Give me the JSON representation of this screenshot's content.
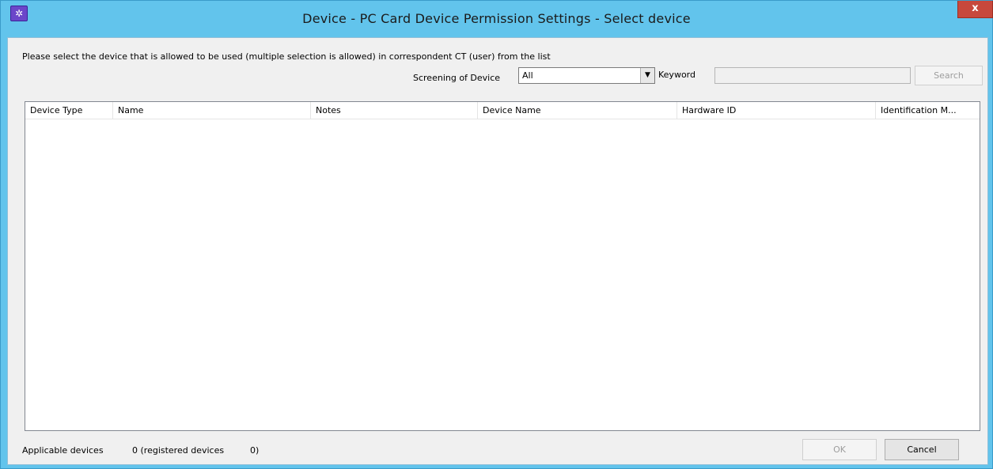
{
  "window": {
    "title": "Device - PC Card Device Permission Settings - Select device",
    "close_label": "x",
    "icon": "app-icon"
  },
  "instruction": "Please select the device that is allowed to be used (multiple selection is allowed) in correspondent CT (user) from the list",
  "filter": {
    "screening_label": "Screening of Device",
    "screening_value": "All",
    "keyword_label": "Keyword",
    "keyword_value": "",
    "search_label": "Search"
  },
  "table": {
    "columns": [
      "Device Type",
      "Name",
      "Notes",
      "Device Name",
      "Hardware ID",
      "Identification M..."
    ],
    "rows": []
  },
  "footer": {
    "applicable_label": "Applicable devices",
    "count_text": "0 (registered devices",
    "registered_text": "0)",
    "ok_label": "OK",
    "cancel_label": "Cancel"
  }
}
